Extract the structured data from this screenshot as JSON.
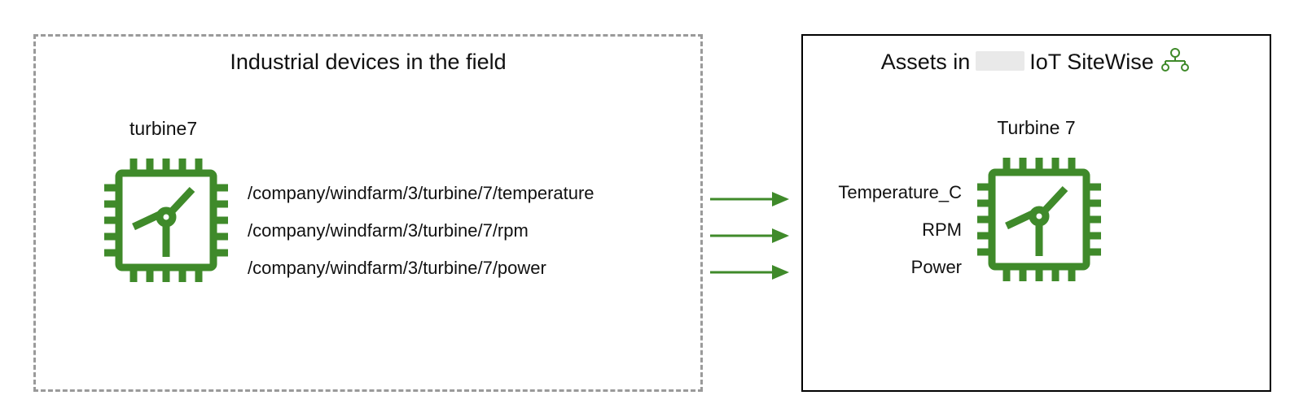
{
  "left": {
    "title": "Industrial devices in the field",
    "device_label": "turbine7",
    "paths": [
      "/company/windfarm/3/turbine/7/temperature",
      "/company/windfarm/3/turbine/7/rpm",
      "/company/windfarm/3/turbine/7/power"
    ]
  },
  "right": {
    "title_prefix": "Assets in",
    "title_suffix": "IoT SiteWise",
    "asset_label": "Turbine 7",
    "properties": [
      "Temperature_C",
      "RPM",
      "Power"
    ]
  },
  "icons": {
    "chip": "turbine-chip-icon",
    "sitewise": "hierarchy-icon",
    "arrow": "arrow-right-icon"
  },
  "colors": {
    "green": "#3f8a2a",
    "dash": "#9a9a9a",
    "black": "#000000"
  }
}
